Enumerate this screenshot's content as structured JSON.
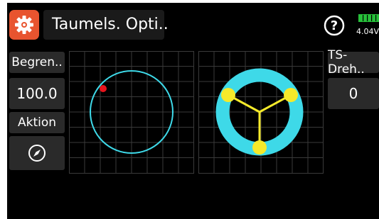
{
  "header": {
    "title": "Taumels. Opti..",
    "app_icon": "gear-icon",
    "help_icon": "question-circle-icon",
    "battery_icon": "battery-icon",
    "voltage": "4.04V"
  },
  "left_column": {
    "limit_label": "Begren..",
    "limit_value": "100.0",
    "action_label": "Aktion",
    "action_icon": "compass-icon"
  },
  "right_column": {
    "rotation_label": "TS-Dreh..",
    "rotation_value": "0"
  },
  "colors": {
    "accent": "#e8542f",
    "cyan": "#3ed9e8",
    "yellow": "#f5ea2a",
    "marker": "#e8141c",
    "grid": "#3a3a3a",
    "battery": "#27c03a"
  }
}
